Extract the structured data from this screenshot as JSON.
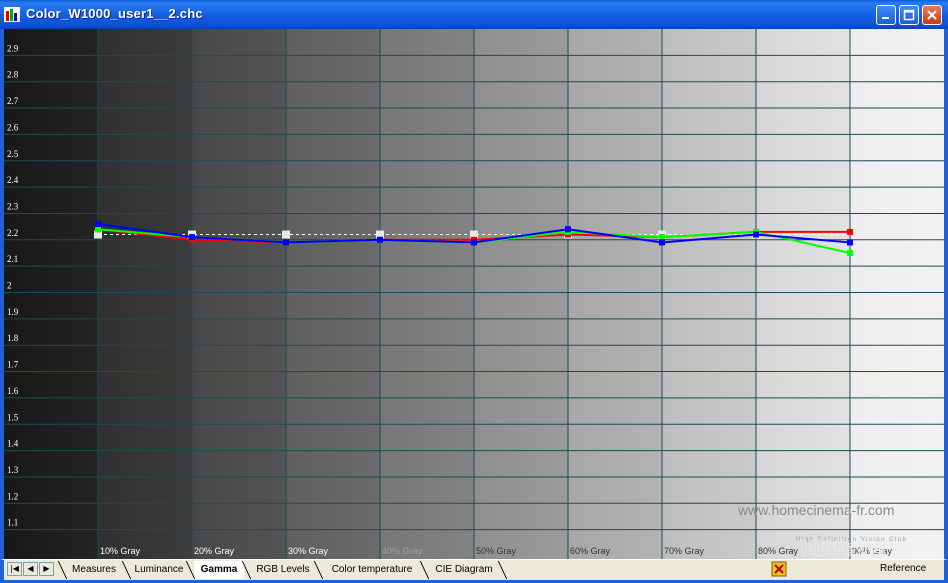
{
  "window": {
    "title": "Color_W1000_user1__2.chc",
    "controls": [
      "minimize",
      "maximize",
      "close"
    ]
  },
  "colors": {
    "titlebar": "#1360e6",
    "grid": "#1f4a55",
    "red_series": "#ff0000",
    "green_series": "#00ff00",
    "blue_series": "#0000ff",
    "reference": "#ffffff"
  },
  "chart_data": {
    "type": "line",
    "categories": [
      "10% Gray",
      "20% Gray",
      "30% Gray",
      "40% Gray",
      "50% Gray",
      "60% Gray",
      "70% Gray",
      "80% Gray",
      "90% Gray"
    ],
    "y_ticks": [
      "1.1",
      "1.2",
      "1.3",
      "1.4",
      "1.5",
      "1.6",
      "1.7",
      "1.8",
      "1.9",
      "2",
      "2.1",
      "2.2",
      "2.3",
      "2.4",
      "2.5",
      "2.6",
      "2.7",
      "2.8",
      "2.9"
    ],
    "ylim": [
      1.0,
      3.0
    ],
    "grid": true,
    "reference": 2.22,
    "series": [
      {
        "values": [
          2.24,
          2.2,
          2.19,
          2.2,
          2.2,
          2.22,
          2.21,
          2.23,
          2.23
        ]
      },
      {
        "values": [
          2.24,
          2.21,
          2.19,
          2.2,
          2.19,
          2.23,
          2.21,
          2.23,
          2.15
        ]
      },
      {
        "values": [
          2.26,
          2.21,
          2.19,
          2.2,
          2.19,
          2.24,
          2.19,
          2.22,
          2.19
        ]
      }
    ],
    "reference_points": [
      2.22,
      2.22,
      2.22,
      2.22,
      2.22,
      2.22,
      2.22,
      2.22
    ]
  },
  "watermark": {
    "site": "www.homecinema-fr.com",
    "club_tag": "High Definition Vision Club",
    "logo": "HDfever"
  },
  "tabs": [
    {
      "label": "Measures",
      "active": false
    },
    {
      "label": "Luminance",
      "active": false
    },
    {
      "label": "Gamma",
      "active": true
    },
    {
      "label": "RGB Levels",
      "active": false
    },
    {
      "label": "Color temperature",
      "active": false
    },
    {
      "label": "CIE Diagram",
      "active": false
    }
  ],
  "status": {
    "reference_label": "Reference"
  }
}
